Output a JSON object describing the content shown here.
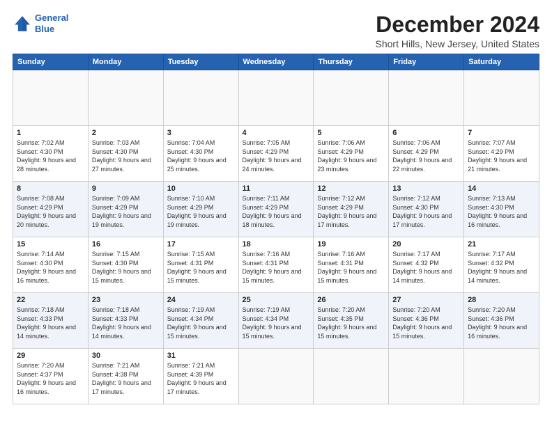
{
  "header": {
    "logo_line1": "General",
    "logo_line2": "Blue",
    "title": "December 2024",
    "subtitle": "Short Hills, New Jersey, United States"
  },
  "calendar": {
    "days_of_week": [
      "Sunday",
      "Monday",
      "Tuesday",
      "Wednesday",
      "Thursday",
      "Friday",
      "Saturday"
    ],
    "weeks": [
      [
        {
          "day": "",
          "empty": true
        },
        {
          "day": "",
          "empty": true
        },
        {
          "day": "",
          "empty": true
        },
        {
          "day": "",
          "empty": true
        },
        {
          "day": "",
          "empty": true
        },
        {
          "day": "",
          "empty": true
        },
        {
          "day": "",
          "empty": true
        }
      ],
      [
        {
          "num": "1",
          "sunrise": "Sunrise: 7:02 AM",
          "sunset": "Sunset: 4:30 PM",
          "daylight": "Daylight: 9 hours and 28 minutes."
        },
        {
          "num": "2",
          "sunrise": "Sunrise: 7:03 AM",
          "sunset": "Sunset: 4:30 PM",
          "daylight": "Daylight: 9 hours and 27 minutes."
        },
        {
          "num": "3",
          "sunrise": "Sunrise: 7:04 AM",
          "sunset": "Sunset: 4:30 PM",
          "daylight": "Daylight: 9 hours and 25 minutes."
        },
        {
          "num": "4",
          "sunrise": "Sunrise: 7:05 AM",
          "sunset": "Sunset: 4:29 PM",
          "daylight": "Daylight: 9 hours and 24 minutes."
        },
        {
          "num": "5",
          "sunrise": "Sunrise: 7:06 AM",
          "sunset": "Sunset: 4:29 PM",
          "daylight": "Daylight: 9 hours and 23 minutes."
        },
        {
          "num": "6",
          "sunrise": "Sunrise: 7:06 AM",
          "sunset": "Sunset: 4:29 PM",
          "daylight": "Daylight: 9 hours and 22 minutes."
        },
        {
          "num": "7",
          "sunrise": "Sunrise: 7:07 AM",
          "sunset": "Sunset: 4:29 PM",
          "daylight": "Daylight: 9 hours and 21 minutes."
        }
      ],
      [
        {
          "num": "8",
          "sunrise": "Sunrise: 7:08 AM",
          "sunset": "Sunset: 4:29 PM",
          "daylight": "Daylight: 9 hours and 20 minutes."
        },
        {
          "num": "9",
          "sunrise": "Sunrise: 7:09 AM",
          "sunset": "Sunset: 4:29 PM",
          "daylight": "Daylight: 9 hours and 19 minutes."
        },
        {
          "num": "10",
          "sunrise": "Sunrise: 7:10 AM",
          "sunset": "Sunset: 4:29 PM",
          "daylight": "Daylight: 9 hours and 19 minutes."
        },
        {
          "num": "11",
          "sunrise": "Sunrise: 7:11 AM",
          "sunset": "Sunset: 4:29 PM",
          "daylight": "Daylight: 9 hours and 18 minutes."
        },
        {
          "num": "12",
          "sunrise": "Sunrise: 7:12 AM",
          "sunset": "Sunset: 4:29 PM",
          "daylight": "Daylight: 9 hours and 17 minutes."
        },
        {
          "num": "13",
          "sunrise": "Sunrise: 7:12 AM",
          "sunset": "Sunset: 4:30 PM",
          "daylight": "Daylight: 9 hours and 17 minutes."
        },
        {
          "num": "14",
          "sunrise": "Sunrise: 7:13 AM",
          "sunset": "Sunset: 4:30 PM",
          "daylight": "Daylight: 9 hours and 16 minutes."
        }
      ],
      [
        {
          "num": "15",
          "sunrise": "Sunrise: 7:14 AM",
          "sunset": "Sunset: 4:30 PM",
          "daylight": "Daylight: 9 hours and 16 minutes."
        },
        {
          "num": "16",
          "sunrise": "Sunrise: 7:15 AM",
          "sunset": "Sunset: 4:30 PM",
          "daylight": "Daylight: 9 hours and 15 minutes."
        },
        {
          "num": "17",
          "sunrise": "Sunrise: 7:15 AM",
          "sunset": "Sunset: 4:31 PM",
          "daylight": "Daylight: 9 hours and 15 minutes."
        },
        {
          "num": "18",
          "sunrise": "Sunrise: 7:16 AM",
          "sunset": "Sunset: 4:31 PM",
          "daylight": "Daylight: 9 hours and 15 minutes."
        },
        {
          "num": "19",
          "sunrise": "Sunrise: 7:16 AM",
          "sunset": "Sunset: 4:31 PM",
          "daylight": "Daylight: 9 hours and 15 minutes."
        },
        {
          "num": "20",
          "sunrise": "Sunrise: 7:17 AM",
          "sunset": "Sunset: 4:32 PM",
          "daylight": "Daylight: 9 hours and 14 minutes."
        },
        {
          "num": "21",
          "sunrise": "Sunrise: 7:17 AM",
          "sunset": "Sunset: 4:32 PM",
          "daylight": "Daylight: 9 hours and 14 minutes."
        }
      ],
      [
        {
          "num": "22",
          "sunrise": "Sunrise: 7:18 AM",
          "sunset": "Sunset: 4:33 PM",
          "daylight": "Daylight: 9 hours and 14 minutes."
        },
        {
          "num": "23",
          "sunrise": "Sunrise: 7:18 AM",
          "sunset": "Sunset: 4:33 PM",
          "daylight": "Daylight: 9 hours and 14 minutes."
        },
        {
          "num": "24",
          "sunrise": "Sunrise: 7:19 AM",
          "sunset": "Sunset: 4:34 PM",
          "daylight": "Daylight: 9 hours and 15 minutes."
        },
        {
          "num": "25",
          "sunrise": "Sunrise: 7:19 AM",
          "sunset": "Sunset: 4:34 PM",
          "daylight": "Daylight: 9 hours and 15 minutes."
        },
        {
          "num": "26",
          "sunrise": "Sunrise: 7:20 AM",
          "sunset": "Sunset: 4:35 PM",
          "daylight": "Daylight: 9 hours and 15 minutes."
        },
        {
          "num": "27",
          "sunrise": "Sunrise: 7:20 AM",
          "sunset": "Sunset: 4:36 PM",
          "daylight": "Daylight: 9 hours and 15 minutes."
        },
        {
          "num": "28",
          "sunrise": "Sunrise: 7:20 AM",
          "sunset": "Sunset: 4:36 PM",
          "daylight": "Daylight: 9 hours and 16 minutes."
        }
      ],
      [
        {
          "num": "29",
          "sunrise": "Sunrise: 7:20 AM",
          "sunset": "Sunset: 4:37 PM",
          "daylight": "Daylight: 9 hours and 16 minutes."
        },
        {
          "num": "30",
          "sunrise": "Sunrise: 7:21 AM",
          "sunset": "Sunset: 4:38 PM",
          "daylight": "Daylight: 9 hours and 17 minutes."
        },
        {
          "num": "31",
          "sunrise": "Sunrise: 7:21 AM",
          "sunset": "Sunset: 4:39 PM",
          "daylight": "Daylight: 9 hours and 17 minutes."
        },
        {
          "empty": true
        },
        {
          "empty": true
        },
        {
          "empty": true
        },
        {
          "empty": true
        }
      ]
    ]
  }
}
